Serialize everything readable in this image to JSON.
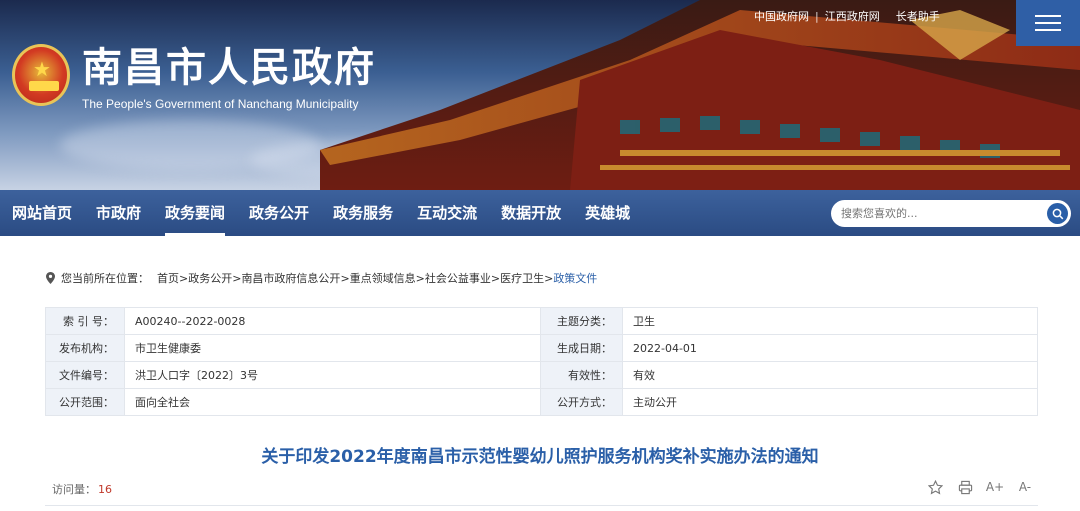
{
  "header": {
    "title": "南昌市人民政府",
    "subtitle": "The People's Government of Nanchang Municipality",
    "top_links": [
      "中国政府网",
      "江西政府网"
    ],
    "assistant": "长者助手",
    "menu_icon": "hamburger-menu-icon"
  },
  "nav": {
    "items": [
      "网站首页",
      "市政府",
      "政务要闻",
      "政务公开",
      "政务服务",
      "互动交流",
      "数据开放",
      "英雄城"
    ],
    "active_index": 2,
    "search_placeholder": "搜索您喜欢的..."
  },
  "breadcrumb": {
    "prefix": "您当前所在位置：",
    "items": [
      "首页",
      "政务公开",
      "南昌市政府信息公开",
      "重点领域信息",
      "社会公益事业",
      "医疗卫生",
      "政策文件"
    ]
  },
  "info": {
    "rows": [
      {
        "l1": "索 引 号：",
        "v1": "A00240--2022-0028",
        "l2": "主题分类：",
        "v2": "卫生"
      },
      {
        "l1": "发布机构：",
        "v1": "市卫生健康委",
        "l2": "生成日期：",
        "v2": "2022-04-01"
      },
      {
        "l1": "文件编号：",
        "v1": "洪卫人口字〔2022〕3号",
        "l2": "有效性：",
        "v2": "有效"
      },
      {
        "l1": "公开范围：",
        "v1": "面向全社会",
        "l2": "公开方式：",
        "v2": "主动公开"
      }
    ]
  },
  "article": {
    "title": "关于印发2022年度南昌市示范性婴幼儿照护服务机构奖补实施办法的通知",
    "visits_label": "访问量：",
    "visits": "16"
  },
  "tools": {
    "enlarge": "A+",
    "shrink": "A-"
  },
  "colors": {
    "nav_bg": "#2c5494",
    "accent": "#2a5fa8",
    "label_bg": "#eef2f8",
    "count": "#c0392b"
  }
}
